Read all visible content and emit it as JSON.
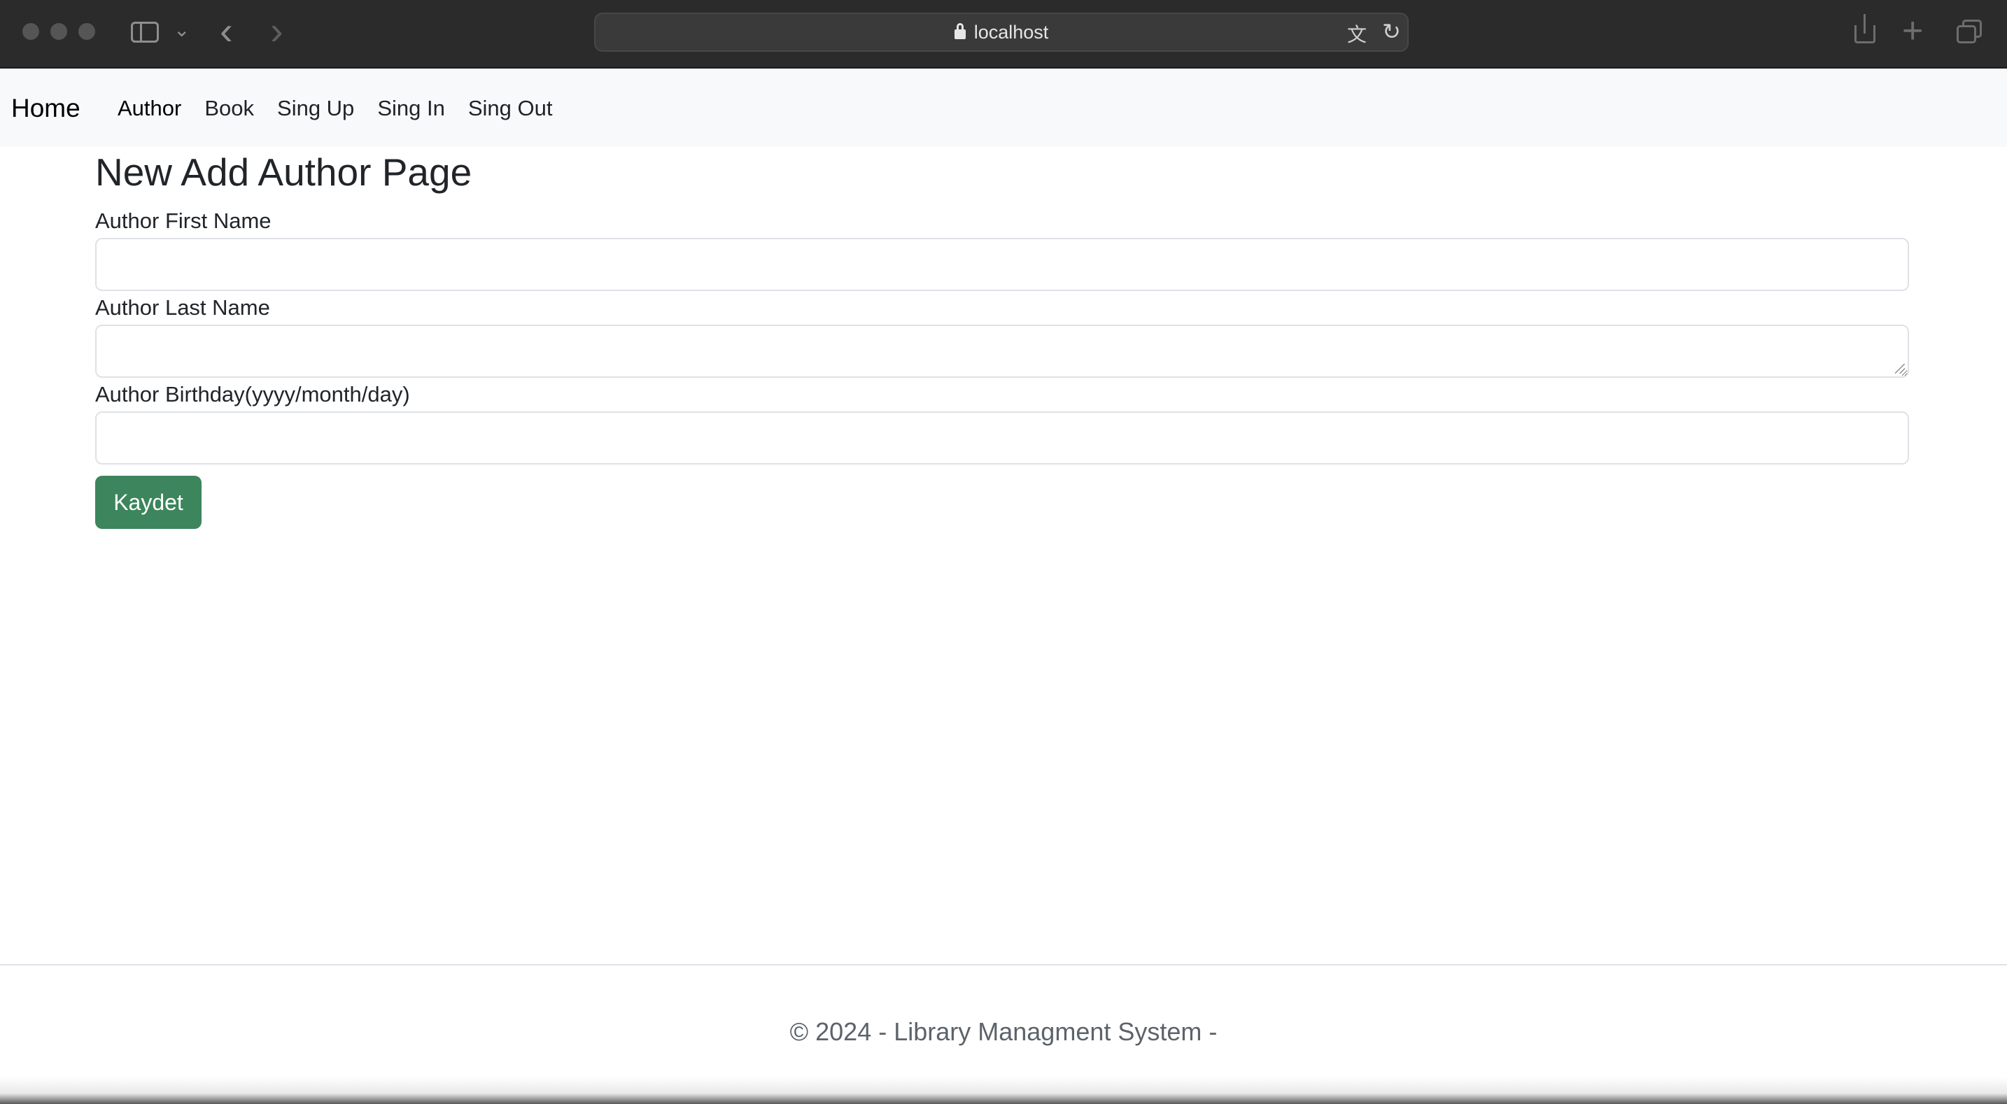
{
  "browser": {
    "address": "localhost",
    "icons": [
      "sidebar-icon",
      "chevron-down-icon",
      "back-arrow-icon",
      "forward-arrow-icon",
      "lock-icon",
      "translate-icon",
      "reload-icon",
      "share-icon",
      "new-tab-icon",
      "tab-overview-icon"
    ]
  },
  "navbar": {
    "brand": "Home",
    "links": [
      "Author",
      "Book",
      "Sing Up",
      "Sing In",
      "Sing Out"
    ]
  },
  "page": {
    "title": "New Add Author Page",
    "fields": [
      {
        "label": "Author First Name",
        "value": "",
        "type": "text"
      },
      {
        "label": "Author Last Name",
        "value": "",
        "type": "textarea"
      },
      {
        "label": "Author Birthday(yyyy/month/day)",
        "value": "",
        "type": "text"
      }
    ],
    "submit_label": "Kaydet"
  },
  "footer": {
    "text": "© 2024 - Library Managment System -"
  },
  "colors": {
    "chrome_bg": "#2b2b2b",
    "navbar_bg": "#f8f9fa",
    "submit_bg": "#3d855d",
    "footer_text": "#5c636a"
  }
}
